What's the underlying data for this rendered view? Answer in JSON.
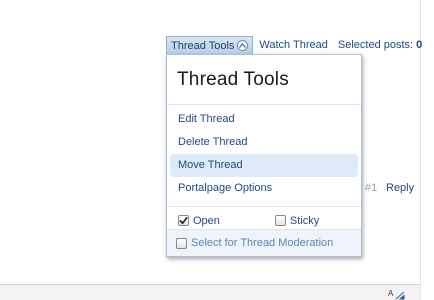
{
  "toolbar": {
    "thread_tools_label": "Thread Tools",
    "watch_thread_label": "Watch Thread",
    "selected_posts_label": "Selected posts:",
    "selected_posts_count": "0"
  },
  "menu": {
    "title": "Thread Tools",
    "items": [
      {
        "label": "Edit Thread"
      },
      {
        "label": "Delete Thread"
      },
      {
        "label": "Move Thread"
      },
      {
        "label": "Portalpage Options"
      }
    ],
    "options": {
      "open_label": "Open",
      "open_checked": true,
      "sticky_label": "Sticky",
      "sticky_checked": false
    },
    "moderation_label": "Select for Thread Moderation",
    "moderation_checked": false
  },
  "post": {
    "number": "#1",
    "reply_label": "Reply"
  },
  "icons": {
    "thread_tools_toggle": "chevron-up-icon",
    "resize": "font-size-icon"
  },
  "colors": {
    "link": "#1f4a82",
    "tab_bg": "#c5d8eb",
    "hover_bg": "#dcebf7",
    "footer_text": "#5b87b6"
  }
}
